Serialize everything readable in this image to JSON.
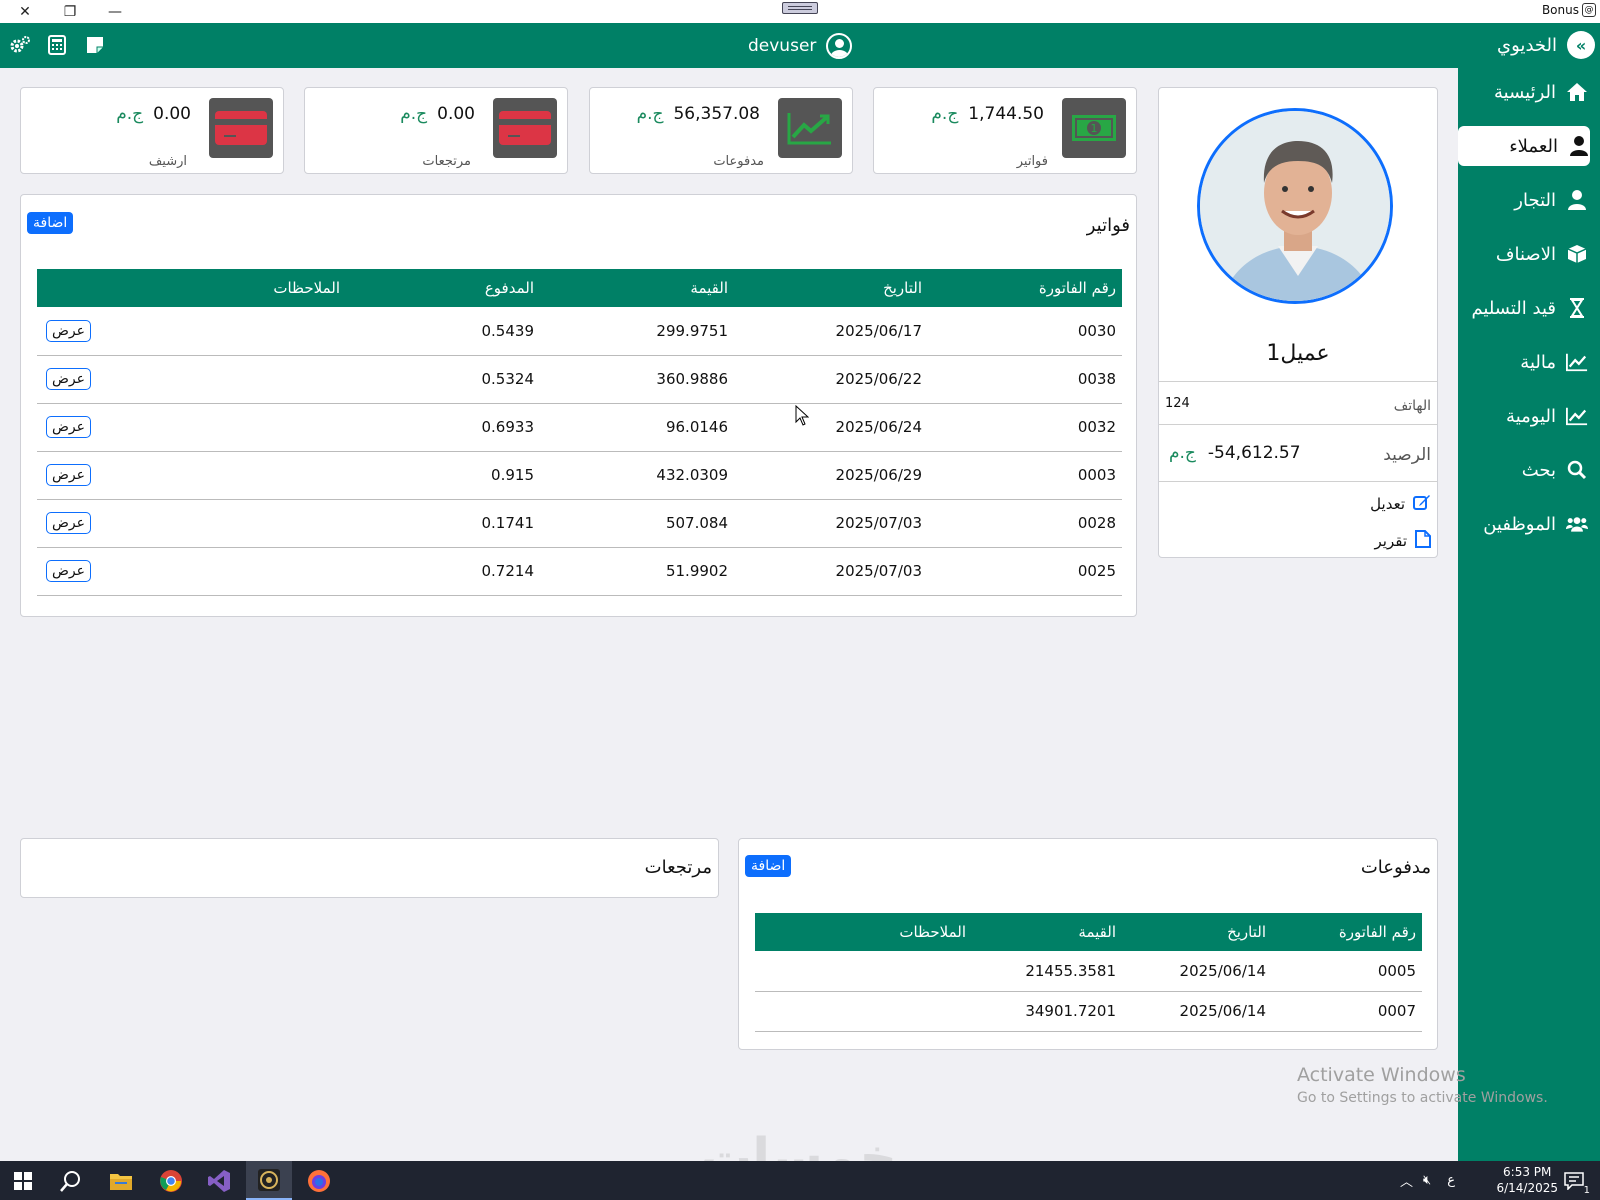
{
  "titlebar": {
    "bonus_label": "Bonus"
  },
  "header": {
    "username": "devuser",
    "brand": "الخديوي"
  },
  "sidebar": {
    "items": [
      {
        "label": "الرئيسية",
        "icon": "home-icon"
      },
      {
        "label": "العملاء",
        "icon": "user-icon",
        "active": true
      },
      {
        "label": "التجار",
        "icon": "user-icon"
      },
      {
        "label": "الاصناف",
        "icon": "box-icon"
      },
      {
        "label": "قيد التسليم",
        "icon": "hourglass-icon"
      },
      {
        "label": "مالية",
        "icon": "chart-line-icon"
      },
      {
        "label": "اليومية",
        "icon": "chart-line-icon"
      },
      {
        "label": "بحث",
        "icon": "search-icon"
      },
      {
        "label": "الموظفين",
        "icon": "users-icon"
      }
    ]
  },
  "stats": [
    {
      "label": "فواتير",
      "amount": "1,744.50",
      "currency": "ج.م",
      "icon": "money-icon",
      "tile_color": "#555555"
    },
    {
      "label": "مدفوعات",
      "amount": "56,357.08",
      "currency": "ج.م",
      "icon": "chart-up-icon",
      "tile_color": "#555555"
    },
    {
      "label": "مرتجعات",
      "amount": "0.00",
      "currency": "ج.م",
      "icon": "credit-card-icon",
      "tile_color": "#dc3545"
    },
    {
      "label": "ارشيف",
      "amount": "0.00",
      "currency": "ج.م",
      "icon": "credit-card-icon",
      "tile_color": "#dc3545"
    }
  ],
  "profile": {
    "name": "عميل1",
    "phone_label": "الهاتف",
    "phone": "124",
    "balance_label": "الرصيد",
    "balance": "-54,612.57",
    "currency": "ج.م",
    "edit_label": "تعديل",
    "report_label": "تقرير"
  },
  "invoices": {
    "title": "فواتير",
    "add_label": "اضافة",
    "columns": [
      "رقم الفاتورة",
      "التاريخ",
      "القيمة",
      "المدفوع",
      "الملاحظات"
    ],
    "view_label": "عرض",
    "rows": [
      {
        "number": "0030",
        "date": "2025/06/17",
        "value": "299.9751",
        "paid": "0.5439"
      },
      {
        "number": "0038",
        "date": "2025/06/22",
        "value": "360.9886",
        "paid": "0.5324"
      },
      {
        "number": "0032",
        "date": "2025/06/24",
        "value": "96.0146",
        "paid": "0.6933"
      },
      {
        "number": "0003",
        "date": "2025/06/29",
        "value": "432.0309",
        "paid": "0.915"
      },
      {
        "number": "0028",
        "date": "2025/07/03",
        "value": "507.084",
        "paid": "0.1741"
      },
      {
        "number": "0025",
        "date": "2025/07/03",
        "value": "51.9902",
        "paid": "0.7214"
      }
    ]
  },
  "payments": {
    "title": "مدفوعات",
    "add_label": "اضافة",
    "columns": [
      "رقم الفاتورة",
      "التاريخ",
      "القيمة",
      "الملاحظات"
    ],
    "rows": [
      {
        "number": "0005",
        "date": "2025/06/14",
        "value": "21455.3581"
      },
      {
        "number": "0007",
        "date": "2025/06/14",
        "value": "34901.7201"
      }
    ]
  },
  "returns": {
    "title": "مرتجعات"
  },
  "watermark": {
    "activate_title": "Activate Windows",
    "activate_sub": "Go to Settings to activate Windows.",
    "site": "خمسات"
  },
  "taskbar": {
    "lang": "ع",
    "time": "6:53 PM",
    "date": "6/14/2025",
    "notifications": "1"
  },
  "colors": {
    "primary": "#008066",
    "accent": "#0d6efd",
    "danger": "#dc3545",
    "currency": "#1a8a5e"
  }
}
